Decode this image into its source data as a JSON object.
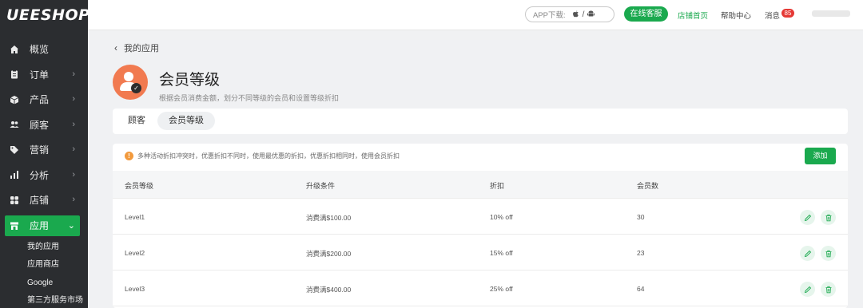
{
  "brand": {
    "logo": "UEESHOP"
  },
  "sidebar": {
    "items": [
      {
        "label": "概览",
        "icon": "home-icon",
        "has_children": false
      },
      {
        "label": "订单",
        "icon": "clipboard-icon",
        "has_children": true
      },
      {
        "label": "产品",
        "icon": "box-icon",
        "has_children": true
      },
      {
        "label": "顾客",
        "icon": "users-icon",
        "has_children": true
      },
      {
        "label": "营销",
        "icon": "tag-icon",
        "has_children": true
      },
      {
        "label": "分析",
        "icon": "bar-chart-icon",
        "has_children": true
      },
      {
        "label": "店铺",
        "icon": "grid-icon",
        "has_children": true
      },
      {
        "label": "应用",
        "icon": "store-icon",
        "has_children": true,
        "active": true
      }
    ],
    "sub_items": [
      "我的应用",
      "应用商店",
      "Google",
      "第三方服务市场"
    ]
  },
  "header": {
    "app_download": "APP下载:",
    "apple_glyph": "",
    "separator": "/",
    "online_service": "在线客服",
    "store_home": "店铺首页",
    "help_center": "帮助中心",
    "messages": "消息",
    "message_count": "85"
  },
  "breadcrumb": {
    "label": "我的应用"
  },
  "page": {
    "title": "会员等级",
    "description": "根据会员消费金额，划分不同等级的会员和设置等级折扣"
  },
  "tabs": [
    {
      "label": "顾客",
      "active": false
    },
    {
      "label": "会员等级",
      "active": true
    }
  ],
  "notice": "多种活动折扣冲突时，优惠折扣不同时，使用最优惠的折扣，优惠折扣相同时，使用会员折扣",
  "add_button": "添加",
  "table": {
    "headers": [
      "会员等级",
      "升级条件",
      "折扣",
      "会员数"
    ],
    "rows": [
      {
        "level": "Level1",
        "condition": "消费满$100.00",
        "discount": "10% off",
        "members": "30"
      },
      {
        "level": "Level2",
        "condition": "消费满$200.00",
        "discount": "15% off",
        "members": "23"
      },
      {
        "level": "Level3",
        "condition": "消费满$400.00",
        "discount": "25% off",
        "members": "64"
      }
    ]
  },
  "colors": {
    "brand_green": "#1aa94e",
    "sidebar_bg": "#2b2d30",
    "app_icon_orange": "#f17a50",
    "badge_red": "#e53935",
    "warning_orange": "#f29a3e"
  }
}
